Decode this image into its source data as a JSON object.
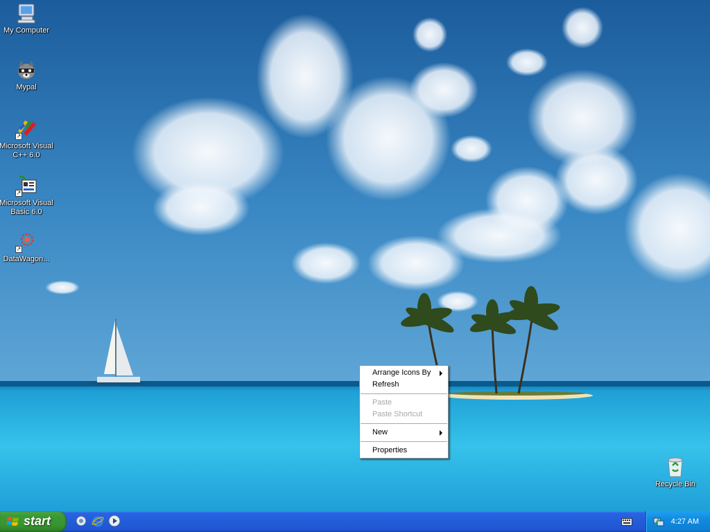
{
  "desktop": {
    "icons": [
      {
        "label": "My Computer",
        "icon": "my-computer-icon"
      },
      {
        "label": "Mypal",
        "icon": "mypal-icon"
      },
      {
        "label": "Microsoft Visual C++ 6.0",
        "icon": "visual-cpp-icon"
      },
      {
        "label": "Microsoft Visual Basic 6.0",
        "icon": "visual-basic-icon"
      },
      {
        "label": "DataWagon...",
        "icon": "datawagon-icon"
      },
      {
        "label": "Recycle Bin",
        "icon": "recycle-bin-icon"
      }
    ]
  },
  "context_menu": {
    "arrange_icons_by": "Arrange Icons By",
    "refresh": "Refresh",
    "paste": "Paste",
    "paste_shortcut": "Paste Shortcut",
    "new": "New",
    "properties": "Properties"
  },
  "taskbar": {
    "start_label": "start",
    "quick_launch": [
      "show-desktop-icon",
      "internet-explorer-icon",
      "media-player-icon"
    ],
    "tray_icons": [
      "keyboard-icon",
      "network-icon"
    ],
    "clock": "4:27 AM"
  },
  "colors": {
    "taskbar_blue": "#245edb",
    "start_green": "#3c9b37",
    "tray_blue": "#118ade",
    "menu_disabled": "#a7a6aa"
  }
}
